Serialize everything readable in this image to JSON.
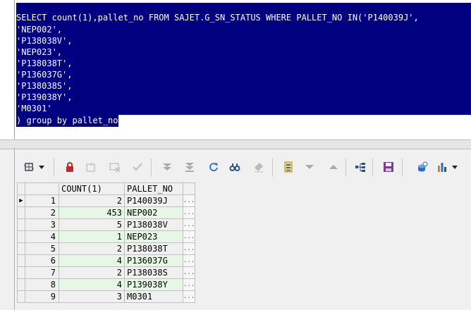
{
  "editor": {
    "lines": [
      "SELECT count(1),pallet_no FROM SAJET.G_SN_STATUS WHERE PALLET_NO IN('P140039J',",
      "'NEP002',",
      "'P138038V',",
      "'NEP023',",
      "'P138038T',",
      "'P136037G',",
      "'P138038S',",
      "'P139038Y',",
      "'M0301'"
    ],
    "last_line_selected": ") group by pallet_no"
  },
  "toolbar": {
    "icons": [
      "grid-options-icon",
      "dropdown-arrow-icon",
      "lock-icon",
      "new-record-icon",
      "delete-record-icon",
      "post-record-icon",
      "fetch-next-icon",
      "fetch-last-icon",
      "refresh-icon",
      "find-icon",
      "clear-icon",
      "export-icon",
      "sort-down-icon",
      "sort-up-icon",
      "tree-icon",
      "save-icon",
      "query-icon",
      "chart-icon",
      "chart-dropdown-icon"
    ]
  },
  "grid": {
    "headers": [
      "COUNT(1)",
      "PALLET_NO"
    ],
    "ellipsis": "...",
    "rows": [
      {
        "num": "1",
        "count": "2",
        "pallet": "P140039J"
      },
      {
        "num": "2",
        "count": "453",
        "pallet": "NEP002"
      },
      {
        "num": "3",
        "count": "5",
        "pallet": "P138038V"
      },
      {
        "num": "4",
        "count": "1",
        "pallet": "NEP023"
      },
      {
        "num": "5",
        "count": "2",
        "pallet": "P138038T"
      },
      {
        "num": "6",
        "count": "4",
        "pallet": "P136037G"
      },
      {
        "num": "7",
        "count": "2",
        "pallet": "P138038S"
      },
      {
        "num": "8",
        "count": "4",
        "pallet": "P139038Y"
      },
      {
        "num": "9",
        "count": "3",
        "pallet": "M0301"
      }
    ]
  },
  "colors": {
    "selection": "#000080",
    "row_alt": "#e6f7e6"
  }
}
